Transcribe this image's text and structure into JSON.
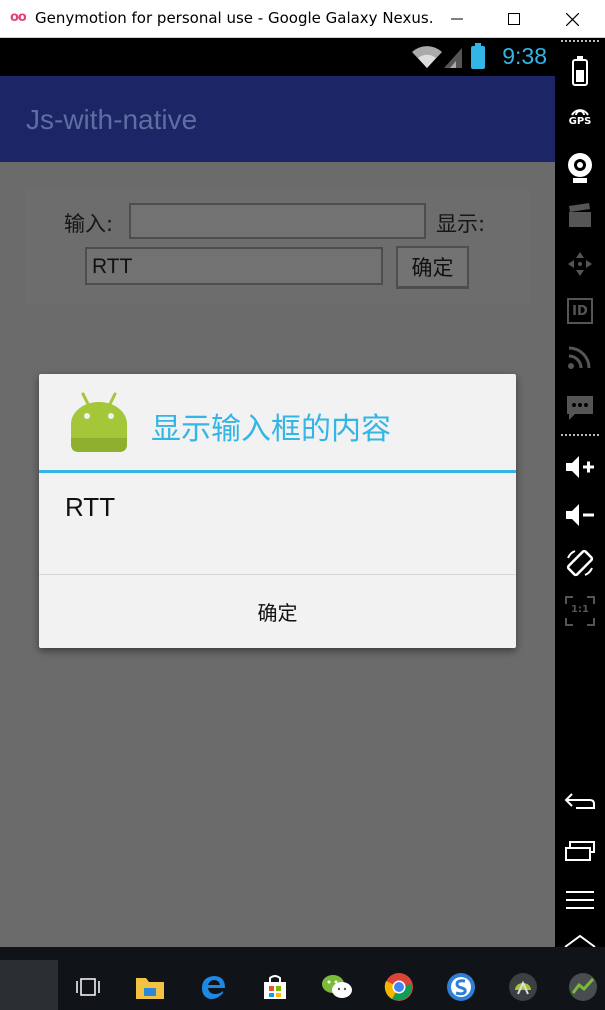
{
  "window": {
    "title": "Genymotion for personal use - Google Galaxy Nexus...",
    "logo": "oo"
  },
  "status_bar": {
    "time": "9:38"
  },
  "app": {
    "title": "Js-with-native"
  },
  "form": {
    "input_label": "输入:",
    "input_value": "",
    "display_label": "显示:",
    "display_value": "RTT",
    "confirm_label": "确定"
  },
  "dialog": {
    "title": "显示输入框的内容",
    "message": "RTT",
    "button_label": "确定"
  },
  "sidebar": {
    "gps_label": "GPS",
    "id_label": "ID",
    "scale_label": "1:1"
  },
  "colors": {
    "accent": "#33b5e5",
    "action_bar": "#1c2566",
    "android_green": "#a4c639"
  }
}
